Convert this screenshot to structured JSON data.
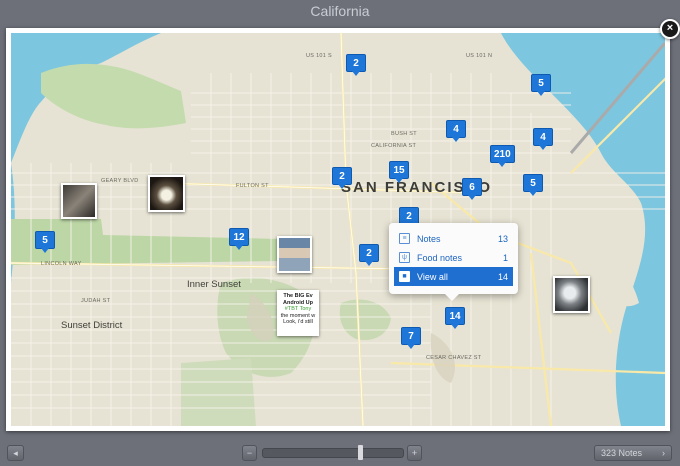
{
  "window": {
    "title": "California"
  },
  "map": {
    "labels": {
      "city": "SAN FRANCISCO",
      "inner_sunset": "Inner Sunset",
      "sunset_district": "Sunset District",
      "streets": [
        "LINCOLN WAY",
        "FULTON ST",
        "GEARY BLVD",
        "US 101 S",
        "JUDAH ST",
        "CESAR CHAVEZ ST",
        "US 101 N",
        "BUSH ST",
        "CALIFORNIA ST"
      ]
    },
    "pins": [
      "2",
      "5",
      "4",
      "4",
      "210",
      "2",
      "15",
      "6",
      "5",
      "5",
      "12",
      "2",
      "2",
      "7",
      "14"
    ],
    "note_card": {
      "line1": "The BIG Ev",
      "line2": "Android Up",
      "line3": "#TBT Tony",
      "line4": "the moment w",
      "line5": "Look, i'd still"
    }
  },
  "popover": {
    "rows": [
      {
        "icon": "notes-icon",
        "label": "Notes",
        "count": "13"
      },
      {
        "icon": "food-notes-icon",
        "label": "Food notes",
        "count": "1"
      },
      {
        "icon": "view-all-icon",
        "label": "View all",
        "count": "14"
      }
    ]
  },
  "controls": {
    "close": "×",
    "prev": "◂",
    "zoom_out": "−",
    "zoom_in": "+",
    "zoom_level": 0.68,
    "notes_button": "323 Notes",
    "notes_arrow": "›"
  },
  "colors": {
    "pin": "#1e77d8",
    "water": "#78c8e0",
    "park": "#b6d3a2"
  }
}
